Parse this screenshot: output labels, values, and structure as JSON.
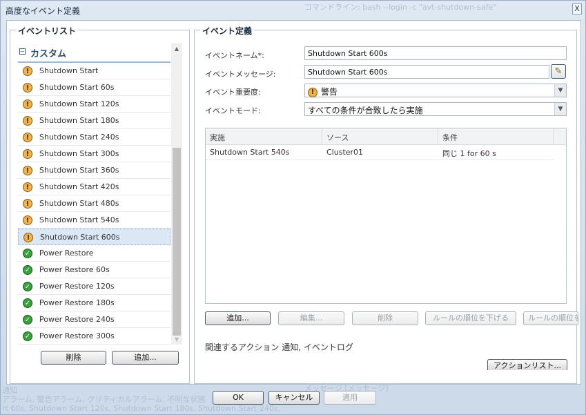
{
  "dialog": {
    "title": "高度なイベント定義",
    "close_label": "X",
    "background_ghost_text": [
      "コマンドライン: bash --login -c \"avt-shutdown-safe\"",
      "メッセージ [メッセージ]",
      "通知",
      "アラーム, 警告アラーム, クリティカルアラーム, 不明な状態",
      "rt 60s, Shutdown Start 120s, Shutdown Start 180s, Shutdown Start 240s,"
    ]
  },
  "event_list": {
    "legend": "イベントリスト",
    "category": {
      "toggle": "−",
      "label": "カスタム"
    },
    "items": [
      {
        "label": "Shutdown Start",
        "icon": "warning-icon",
        "selected": false
      },
      {
        "label": "Shutdown Start 60s",
        "icon": "warning-icon",
        "selected": false
      },
      {
        "label": "Shutdown Start 120s",
        "icon": "warning-icon",
        "selected": false
      },
      {
        "label": "Shutdown Start 180s",
        "icon": "warning-icon",
        "selected": false
      },
      {
        "label": "Shutdown Start 240s",
        "icon": "warning-icon",
        "selected": false
      },
      {
        "label": "Shutdown Start 300s",
        "icon": "warning-icon",
        "selected": false
      },
      {
        "label": "Shutdown Start 360s",
        "icon": "warning-icon",
        "selected": false
      },
      {
        "label": "Shutdown Start 420s",
        "icon": "warning-icon",
        "selected": false
      },
      {
        "label": "Shutdown Start 480s",
        "icon": "warning-icon",
        "selected": false
      },
      {
        "label": "Shutdown Start 540s",
        "icon": "warning-icon",
        "selected": false
      },
      {
        "label": "Shutdown Start 600s",
        "icon": "warning-icon",
        "selected": true
      },
      {
        "label": "Power Restore",
        "icon": "check-icon",
        "selected": false
      },
      {
        "label": "Power Restore 60s",
        "icon": "check-icon",
        "selected": false
      },
      {
        "label": "Power Restore 120s",
        "icon": "check-icon",
        "selected": false
      },
      {
        "label": "Power Restore 180s",
        "icon": "check-icon",
        "selected": false
      },
      {
        "label": "Power Restore 240s",
        "icon": "check-icon",
        "selected": false
      },
      {
        "label": "Power Restore 300s",
        "icon": "check-icon",
        "selected": false
      }
    ],
    "buttons": {
      "delete": "削除",
      "add": "追加..."
    }
  },
  "event_definition": {
    "legend": "イベント定義",
    "name_label": "イベントネーム*:",
    "name_value": "Shutdown Start 600s",
    "message_label": "イベントメッセージ:",
    "message_value": "Shutdown Start 600s",
    "severity_label": "イベント重要度:",
    "severity_value": "警告",
    "mode_label": "イベントモード:",
    "mode_value": "すべての条件が合致したら実施",
    "rules": {
      "columns": [
        "実施",
        "ソース",
        "条件"
      ],
      "rows": [
        {
          "action": "Shutdown Start 540s",
          "source": "Cluster01",
          "condition": "同じ 1 for 60 s"
        }
      ]
    },
    "rule_buttons": {
      "add": "追加...",
      "edit": "編集...",
      "delete": "削除",
      "move_down": "ルールの順位を下げる",
      "move_up": "ルールの順位を上げる"
    },
    "related_actions": "関連するアクション 通知, イベントログ",
    "action_list_button": "アクションリスト..."
  },
  "footer": {
    "ok": "OK",
    "cancel": "キャンセル",
    "apply": "適用"
  }
}
